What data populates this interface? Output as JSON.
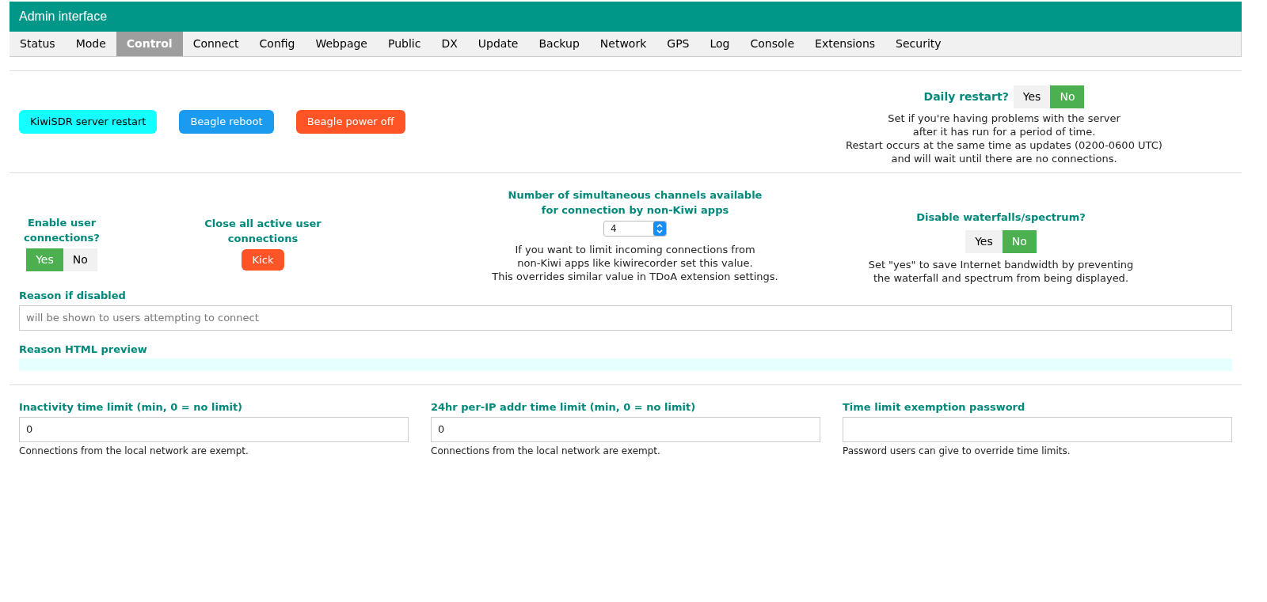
{
  "header": {
    "title": "Admin interface"
  },
  "tabs": [
    {
      "label": "Status",
      "selected": false
    },
    {
      "label": "Mode",
      "selected": false
    },
    {
      "label": "Control",
      "selected": true
    },
    {
      "label": "Connect",
      "selected": false
    },
    {
      "label": "Config",
      "selected": false
    },
    {
      "label": "Webpage",
      "selected": false
    },
    {
      "label": "Public",
      "selected": false
    },
    {
      "label": "DX",
      "selected": false
    },
    {
      "label": "Update",
      "selected": false
    },
    {
      "label": "Backup",
      "selected": false
    },
    {
      "label": "Network",
      "selected": false
    },
    {
      "label": "GPS",
      "selected": false
    },
    {
      "label": "Log",
      "selected": false
    },
    {
      "label": "Console",
      "selected": false
    },
    {
      "label": "Extensions",
      "selected": false
    },
    {
      "label": "Security",
      "selected": false
    }
  ],
  "actions": [
    {
      "label": "KiwiSDR server restart",
      "color": "#14ffff"
    },
    {
      "label": "Beagle reboot",
      "color": "#1a9bef"
    },
    {
      "label": "Beagle power off",
      "color": "#fe5426"
    }
  ],
  "daily_restart": {
    "label": "Daily restart?",
    "options": [
      {
        "label": "Yes",
        "selected": false
      },
      {
        "label": "No",
        "selected": true
      }
    ],
    "description": [
      "Set if you're having problems with the server",
      "after it has run for a period of time.",
      "Restart occurs at the same time as updates (0200-0600 UTC)",
      "and will wait until there are no connections."
    ]
  },
  "enable_connections": {
    "label": "Enable user connections?",
    "options": [
      {
        "label": "Yes",
        "selected": true
      },
      {
        "label": "No",
        "selected": false
      }
    ]
  },
  "kick": {
    "label": "Close all active user connections",
    "button": "Kick"
  },
  "channels": {
    "label": [
      "Number of simultaneous channels available",
      "for connection by non-Kiwi apps"
    ],
    "value": "4",
    "description": [
      "If you want to limit incoming connections from",
      "non-Kiwi apps like kiwirecorder set this value.",
      "This overrides similar value in TDoA extension settings."
    ]
  },
  "disable_waterfalls": {
    "label": "Disable waterfalls/spectrum?",
    "options": [
      {
        "label": "Yes",
        "selected": false
      },
      {
        "label": "No",
        "selected": true
      }
    ],
    "description": [
      "Set \"yes\" to save Internet bandwidth by preventing",
      "the waterfall and spectrum from being displayed."
    ]
  },
  "reason": {
    "label": "Reason if disabled",
    "placeholder": "will be shown to users attempting to connect"
  },
  "preview": {
    "label": "Reason HTML preview"
  },
  "limits": [
    {
      "label": "Inactivity time limit (min, 0 = no limit)",
      "value": "0",
      "note": "Connections from the local network are exempt."
    },
    {
      "label": "24hr per-IP addr time limit (min, 0 = no limit)",
      "value": "0",
      "note": "Connections from the local network are exempt."
    },
    {
      "label": "Time limit exemption password",
      "note": "Password users can give to override time limits."
    }
  ]
}
